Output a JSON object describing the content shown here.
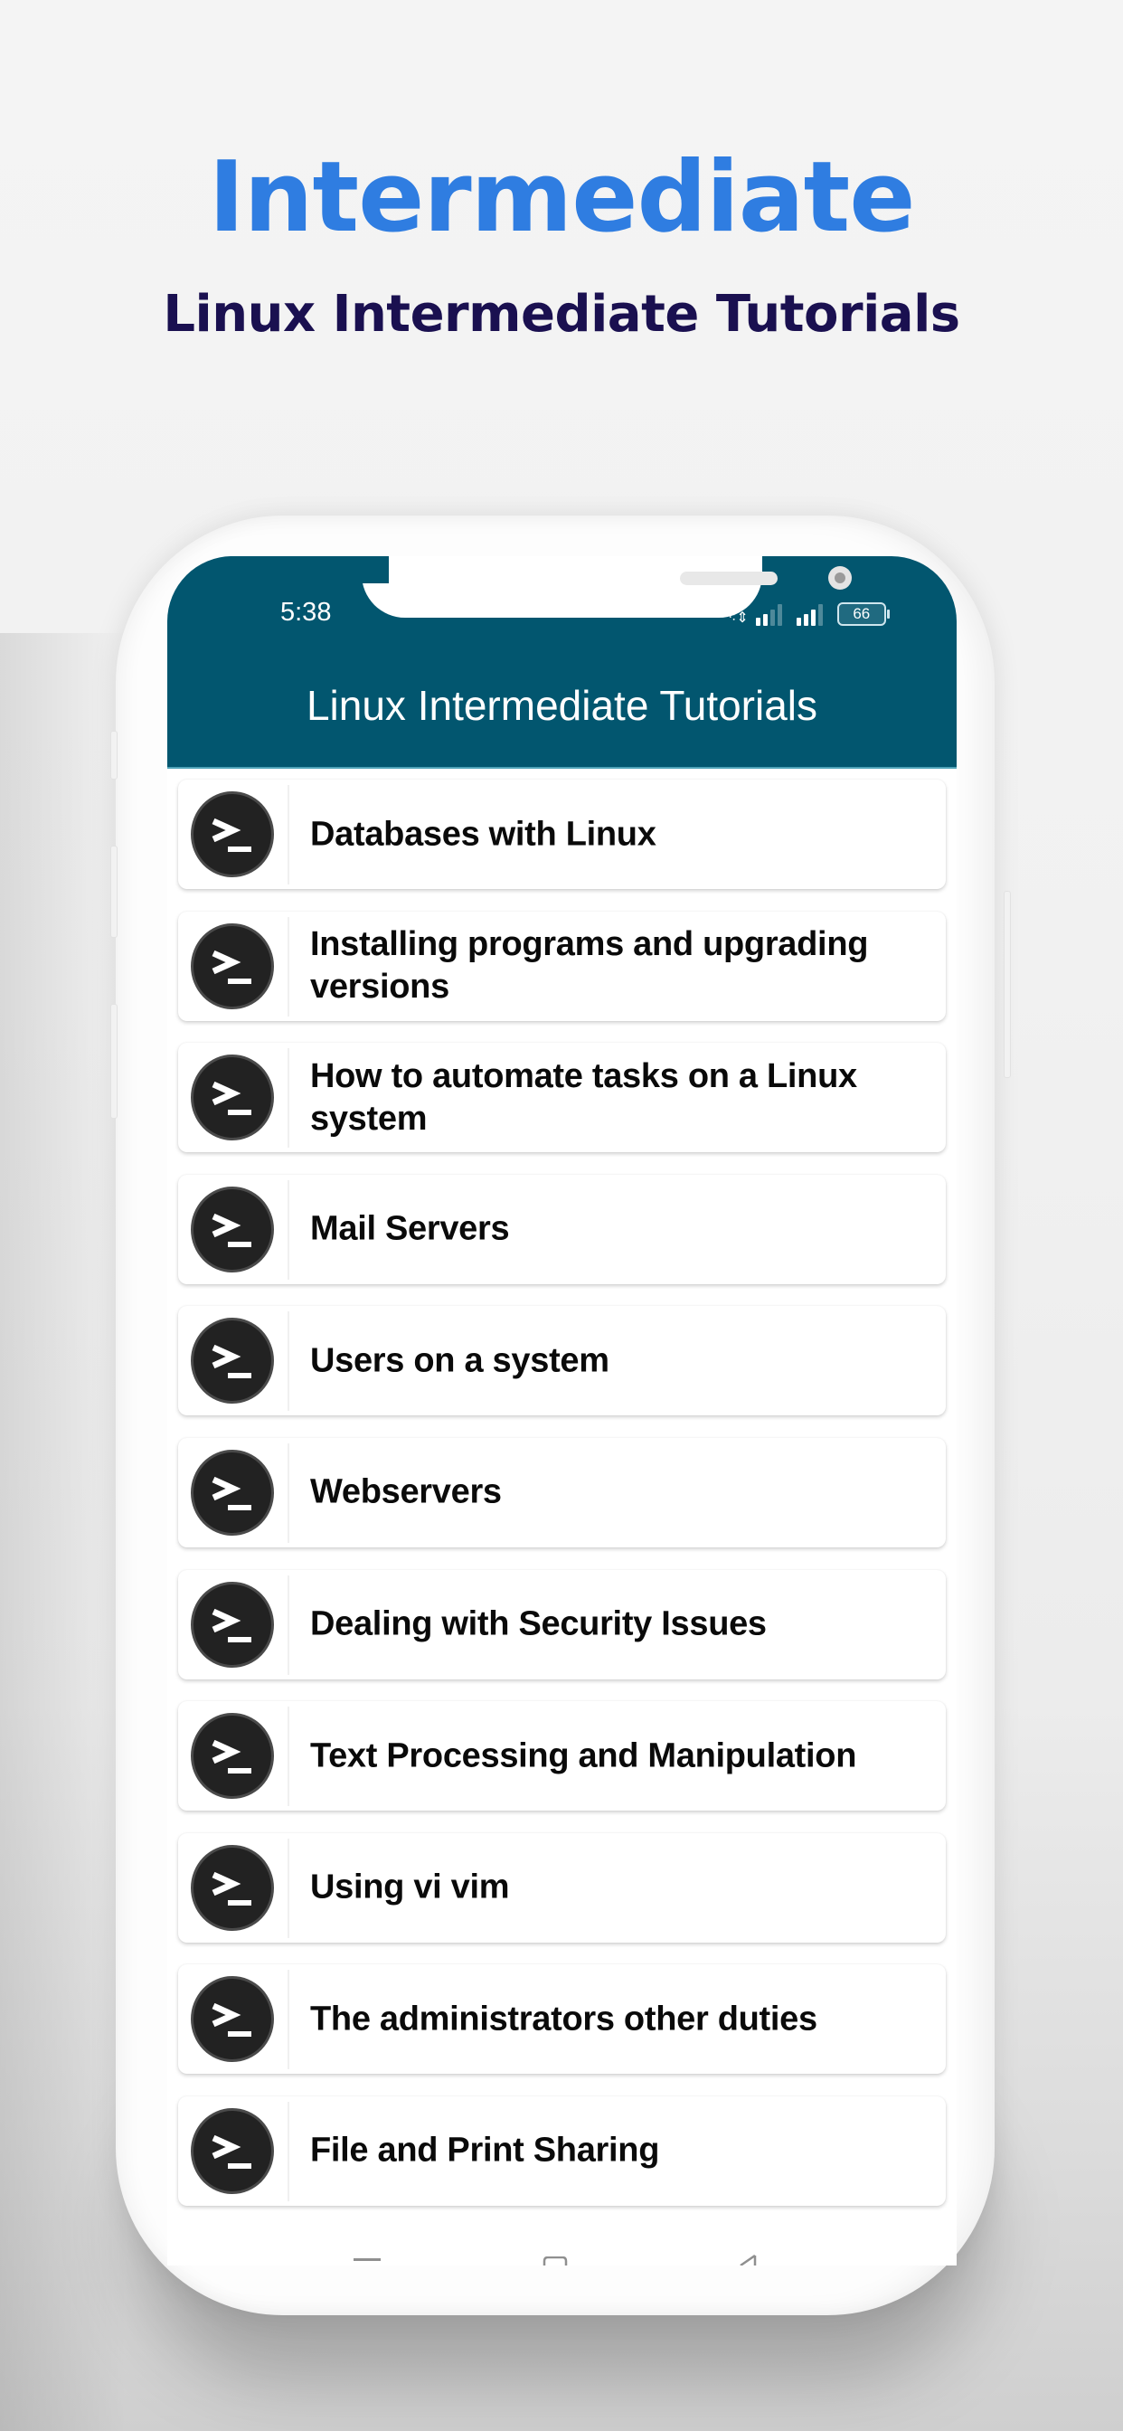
{
  "promo": {
    "headline": "Intermediate",
    "subheadline": "Linux Intermediate Tutorials",
    "headline_color": "#2f7de1",
    "subheadline_color": "#1a1050"
  },
  "status_bar": {
    "time": "5:38",
    "battery": "66",
    "icons": [
      "data-arrows-icon",
      "signal-icon",
      "signal-icon",
      "battery-icon"
    ]
  },
  "app_bar": {
    "title": "Linux Intermediate Tutorials",
    "color": "#02566f"
  },
  "tutorials": [
    {
      "label": "Databases with Linux",
      "icon": "terminal-icon"
    },
    {
      "label": "Installing programs and upgrading versions",
      "icon": "terminal-icon"
    },
    {
      "label": "How to automate tasks on a Linux system",
      "icon": "terminal-icon"
    },
    {
      "label": "Mail Servers",
      "icon": "terminal-icon"
    },
    {
      "label": "Users on a system",
      "icon": "terminal-icon"
    },
    {
      "label": "Webservers",
      "icon": "terminal-icon"
    },
    {
      "label": "Dealing with Security Issues",
      "icon": "terminal-icon"
    },
    {
      "label": "Text Processing and Manipulation",
      "icon": "terminal-icon"
    },
    {
      "label": "Using vi vim",
      "icon": "terminal-icon"
    },
    {
      "label": "The administrators other duties",
      "icon": "terminal-icon"
    },
    {
      "label": "File and Print Sharing",
      "icon": "terminal-icon"
    }
  ],
  "nav_bar": {
    "buttons": [
      "recents-icon",
      "home-icon",
      "back-icon"
    ]
  }
}
